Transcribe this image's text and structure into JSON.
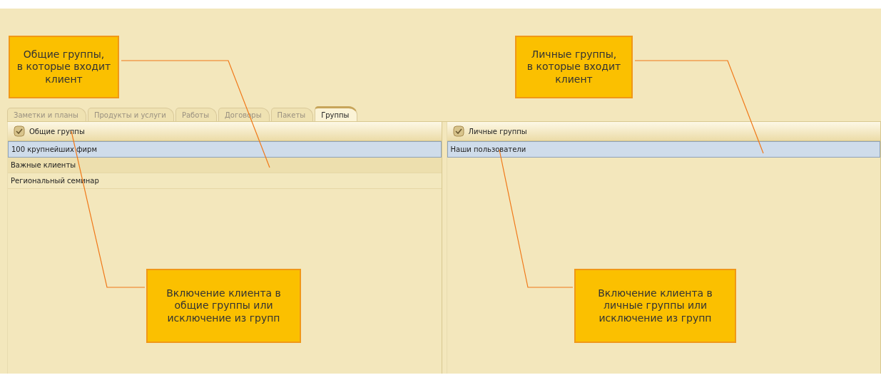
{
  "tabs": [
    {
      "label": "Заметки и планы",
      "selected": false
    },
    {
      "label": "Продукты и услуги",
      "selected": false
    },
    {
      "label": "Работы",
      "selected": false
    },
    {
      "label": "Договоры",
      "selected": false
    },
    {
      "label": "Пакеты",
      "selected": false
    },
    {
      "label": "Группы",
      "selected": true
    }
  ],
  "panels": [
    {
      "title": "Общие группы",
      "rows": [
        {
          "label": "100 крупнейших фирм",
          "selected": true
        },
        {
          "label": "Важные клиенты",
          "selected": false
        },
        {
          "label": "Региональный семинар",
          "selected": false
        }
      ]
    },
    {
      "title": "Личные группы",
      "rows": [
        {
          "label": "Наши пользователи",
          "selected": true
        }
      ]
    }
  ],
  "callouts": [
    "Общие группы,\nв которые входит\nклиент",
    "Личные группы,\nв которые входит\nклиент",
    "Включение клиента в\nобщие группы или\nисключение из групп",
    "Включение клиента в\nличные группы или\nисключение из групп"
  ]
}
